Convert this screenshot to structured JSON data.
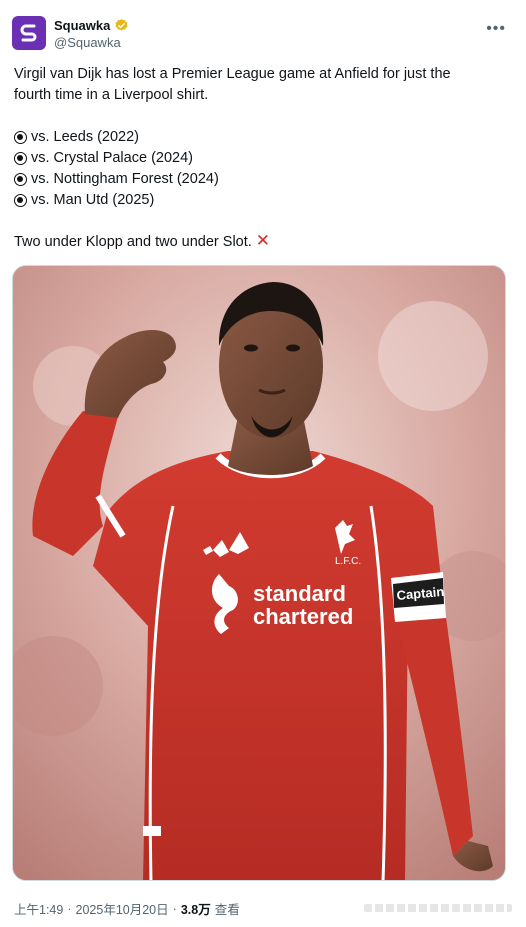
{
  "tweet": {
    "display_name": "Squawka",
    "handle": "@Squawka",
    "more_icon": "more-options-icon",
    "verified_icon": "verified-badge-icon",
    "line1": "Virgil van Dijk has lost a Premier League game at Anfield for just the",
    "line2": "fourth time in a Liverpool shirt.",
    "bullets": [
      "vs. Leeds (2022)",
      "vs. Crystal Palace (2024)",
      "vs. Nottingham Forest (2024)",
      "vs. Man Utd (2025)"
    ],
    "closing": "Two under Klopp and two under Slot.",
    "closing_emoji": "cross-mark-icon"
  },
  "media": {
    "image_semantic": "player-photo",
    "sponsor_line1": "standard",
    "sponsor_line2": "chartered",
    "badge_text": "L.F.C.",
    "armband_text": "Captain"
  },
  "footer": {
    "time": "上午1:49",
    "sep1": "·",
    "date": "2025年10月20日",
    "sep2": "·",
    "views": "3.8万",
    "views_label": "查看"
  },
  "colors": {
    "brand_purple": "#6b2fb3",
    "verified_gold": "#e2b719",
    "shirt_red": "#c8352b"
  }
}
